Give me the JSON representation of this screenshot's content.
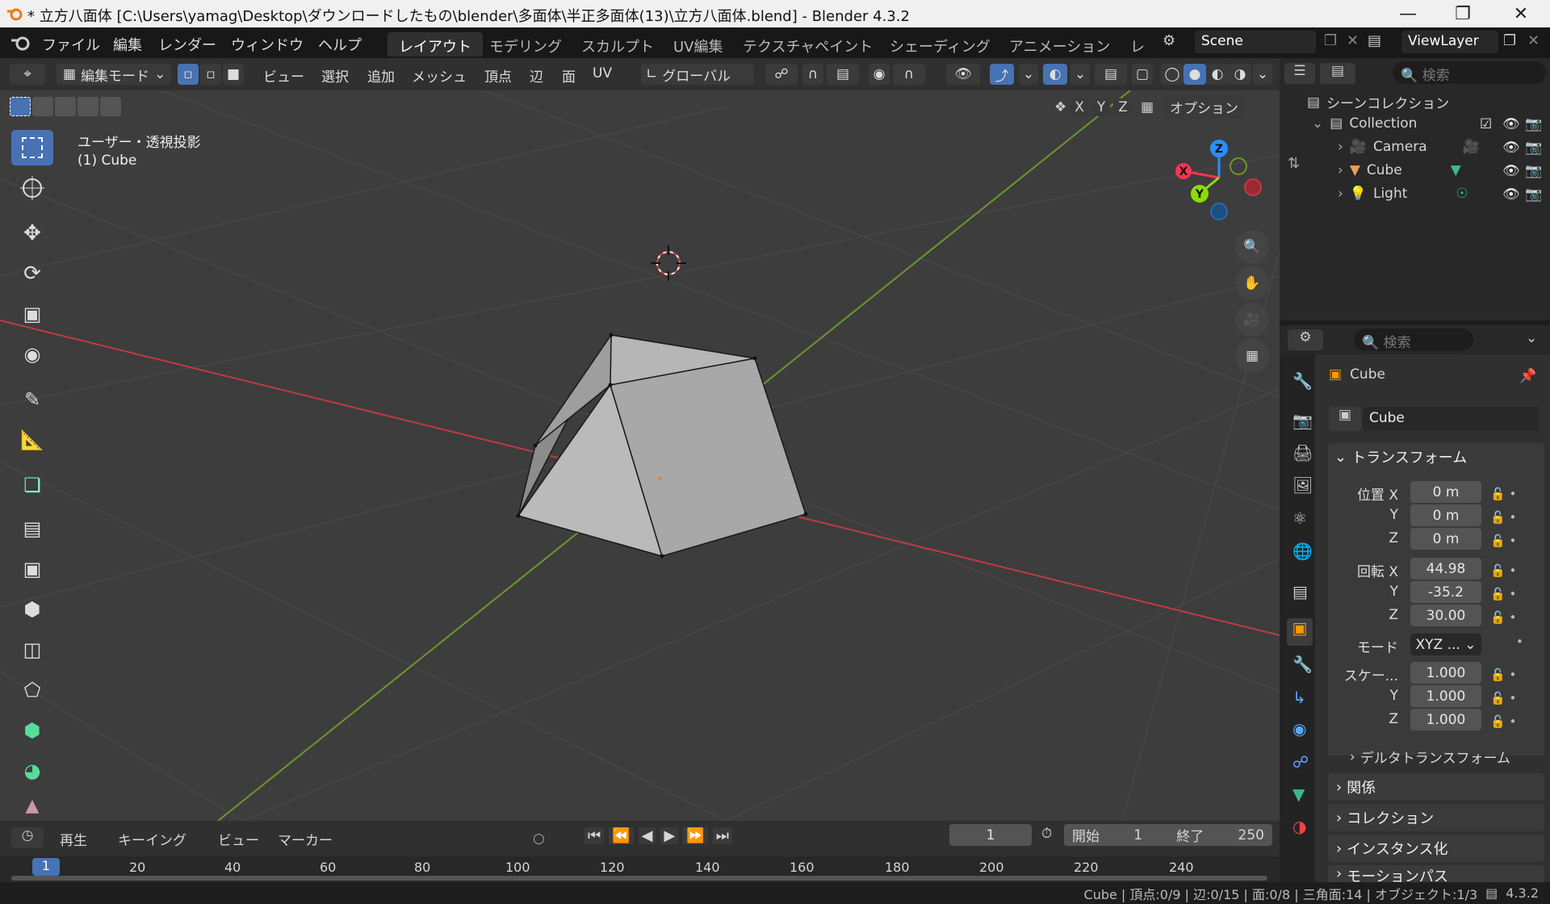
{
  "titlebar": {
    "title": "* 立方八面体 [C:\\Users\\yamag\\Desktop\\ダウンロードしたもの\\blender\\多面体\\半正多面体(13)\\立方八面体.blend] - Blender 4.3.2"
  },
  "menu": [
    "ファイル",
    "編集",
    "レンダー",
    "ウィンドウ",
    "ヘルプ"
  ],
  "workspaces": [
    "レイアウト",
    "モデリング",
    "スカルプト",
    "UV編集",
    "テクスチャペイント",
    "シェーディング",
    "アニメーション",
    "レ"
  ],
  "scene": "Scene",
  "view_layer": "ViewLayer",
  "v3d_header": {
    "mode": "編集モード",
    "menus": [
      "ビュー",
      "選択",
      "追加",
      "メッシュ",
      "頂点",
      "辺",
      "面",
      "UV"
    ],
    "orientation": "グローバル",
    "options": "オプション",
    "axes": [
      "X",
      "Y",
      "Z"
    ]
  },
  "viewport": {
    "view_name": "ユーザー・透視投影",
    "object_label": "(1) Cube",
    "gizmo": {
      "x": "X",
      "y": "Y",
      "z": "Z"
    }
  },
  "outliner": {
    "search_placeholder": "検索",
    "scene_collection": "シーンコレクション",
    "collection": "Collection",
    "items": [
      {
        "name": "Camera"
      },
      {
        "name": "Cube"
      },
      {
        "name": "Light"
      }
    ]
  },
  "properties": {
    "search_placeholder": "検索",
    "object_name": "Cube",
    "object_field": "Cube",
    "transform_title": "トランスフォーム",
    "location_label": "位置 X",
    "location": {
      "x": "0 m",
      "y": "0 m",
      "z": "0 m"
    },
    "rotation_label": "回転 X",
    "rotation": {
      "x": "44.98",
      "y": "-35.2",
      "z": "30.00"
    },
    "mode_label": "モード",
    "mode_value": "XYZ ...",
    "scale_label": "スケー...",
    "scale": {
      "x": "1.000",
      "y": "1.000",
      "z": "1.000"
    },
    "axis_y": "Y",
    "axis_z": "Z",
    "panels": [
      "デルタトランスフォーム",
      "関係",
      "コレクション",
      "インスタンス化",
      "モーションパス"
    ]
  },
  "timeline": {
    "menus": [
      "再生",
      "キーイング",
      "ビュー",
      "マーカー"
    ],
    "current_frame": "1",
    "start_label": "開始",
    "start": "1",
    "end_label": "終了",
    "end": "250",
    "ruler": [
      "1",
      "20",
      "40",
      "60",
      "80",
      "100",
      "120",
      "140",
      "160",
      "180",
      "200",
      "220",
      "240"
    ]
  },
  "statusbar": {
    "text": "Cube | 頂点:0/9 | 辺:0/15 | 面:0/8 | 三角面:14 | オブジェクト:1/3",
    "version": "4.3.2"
  },
  "colors": {
    "accent": "#4772b3",
    "x_axis": "#ff3352",
    "y_axis": "#8bdc00",
    "z_axis": "#2890ff"
  }
}
